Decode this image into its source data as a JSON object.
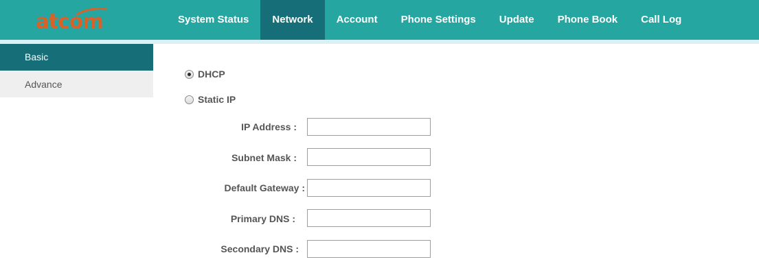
{
  "brand": {
    "logo_text": "atcom",
    "logo_color": "#d8612a"
  },
  "colors": {
    "topbar": "#26a6a0",
    "active": "#166f78",
    "strip": "#d9f1f4",
    "sidebar_inactive": "#efefef"
  },
  "nav": {
    "items": [
      {
        "label": "System Status"
      },
      {
        "label": "Network"
      },
      {
        "label": "Account"
      },
      {
        "label": "Phone Settings"
      },
      {
        "label": "Update"
      },
      {
        "label": "Phone Book"
      },
      {
        "label": "Call Log"
      }
    ],
    "active": "Network"
  },
  "sidebar": {
    "items": [
      {
        "label": "Basic"
      },
      {
        "label": "Advance"
      }
    ],
    "active": "Basic"
  },
  "network": {
    "mode_options": [
      {
        "label": "DHCP",
        "checked": true
      },
      {
        "label": "Static IP",
        "checked": false
      }
    ],
    "fields": [
      {
        "label": "IP Address :",
        "value": ""
      },
      {
        "label": "Subnet Mask :",
        "value": ""
      },
      {
        "label": "Default Gateway :",
        "value": ""
      },
      {
        "label": "Primary DNS :",
        "value": ""
      },
      {
        "label": "Secondary DNS :",
        "value": ""
      }
    ]
  }
}
